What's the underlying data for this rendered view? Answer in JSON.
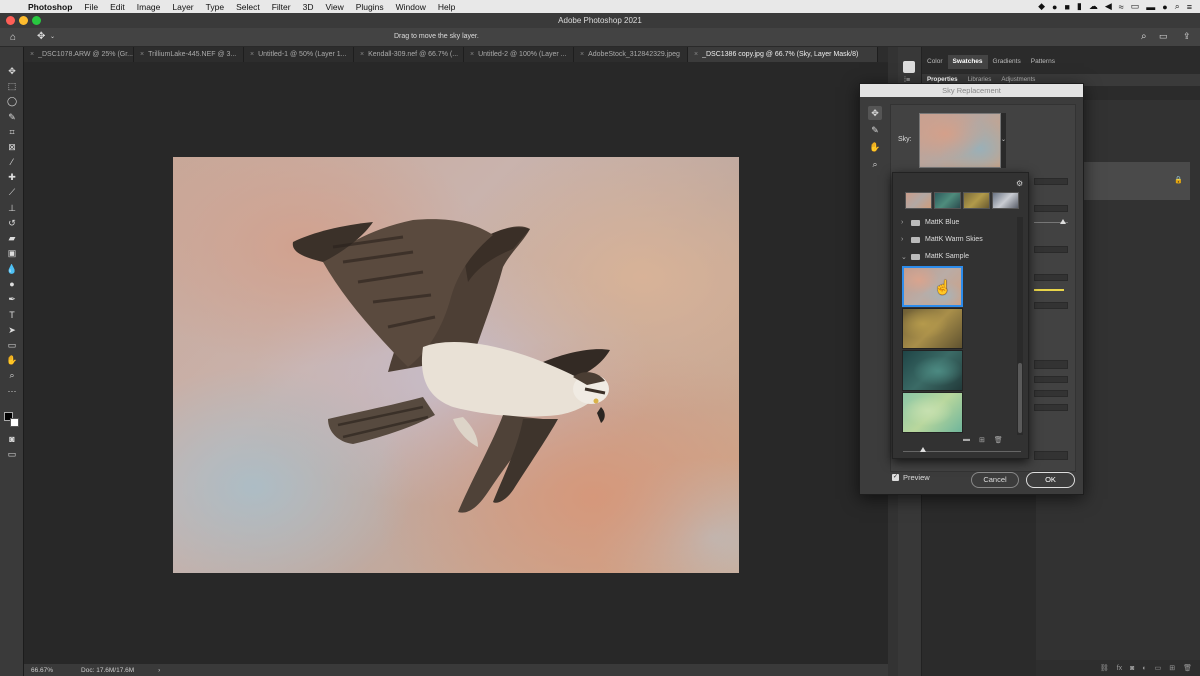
{
  "menubar": {
    "app": "Photoshop",
    "items": [
      "File",
      "Edit",
      "Image",
      "Layer",
      "Type",
      "Select",
      "Filter",
      "3D",
      "View",
      "Plugins",
      "Window",
      "Help"
    ]
  },
  "window": {
    "title": "Adobe Photoshop 2021"
  },
  "options_bar": {
    "hint": "Drag to move the sky layer."
  },
  "tabs": [
    {
      "label": "_DSC1078.ARW @ 25% (Gr..."
    },
    {
      "label": "TrilliumLake-445.NEF @ 3..."
    },
    {
      "label": "Untitled-1 @ 50% (Layer 1..."
    },
    {
      "label": "Kendall-309.nef @ 66.7% (..."
    },
    {
      "label": "Untitled-2 @ 100% (Layer ..."
    },
    {
      "label": "AdobeStock_312842329.jpeg"
    },
    {
      "label": "_DSC1386 copy.jpg @ 66.7% (Sky, Layer Mask/8)"
    }
  ],
  "status": {
    "zoom": "66.67%",
    "doc": "Doc: 17.6M/17.6M",
    "arrow": "›"
  },
  "panels": {
    "top_tabs": [
      "Color",
      "Swatches",
      "Gradients",
      "Patterns"
    ],
    "active_top_tab": "Swatches",
    "prop_tabs": [
      "Properties",
      "Libraries",
      "Adjustments"
    ]
  },
  "dialog": {
    "title": "Sky Replacement",
    "sky_label": "Sky:",
    "folders": [
      "MattK Blue",
      "MattK Warm Skies",
      "MattK Sample"
    ],
    "preview_label": "Preview",
    "preview_checked": true,
    "cancel_label": "Cancel",
    "ok_label": "OK",
    "gear_icon": "gear-icon"
  },
  "colors": {
    "accent": "#2d8ceb",
    "dialog_bg": "#3c3c3c",
    "canvas_bg": "#282828"
  }
}
